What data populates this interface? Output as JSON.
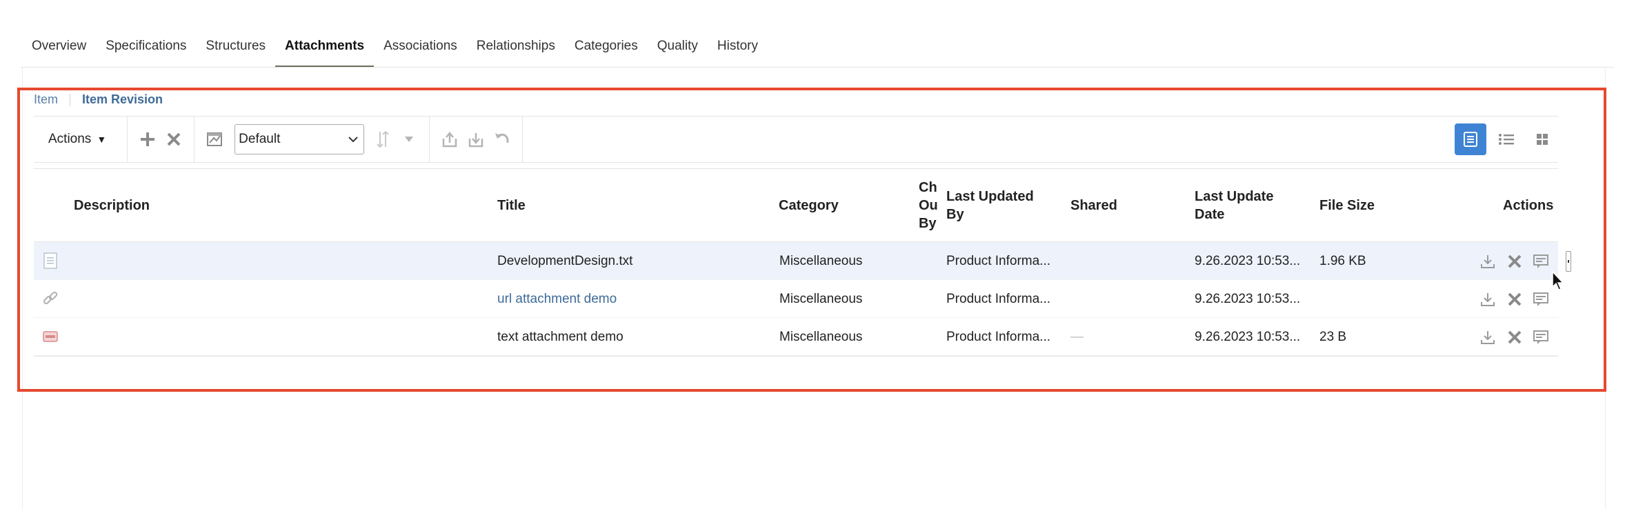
{
  "tabs": [
    {
      "label": "Overview",
      "active": false
    },
    {
      "label": "Specifications",
      "active": false
    },
    {
      "label": "Structures",
      "active": false
    },
    {
      "label": "Attachments",
      "active": true
    },
    {
      "label": "Associations",
      "active": false
    },
    {
      "label": "Relationships",
      "active": false
    },
    {
      "label": "Categories",
      "active": false
    },
    {
      "label": "Quality",
      "active": false
    },
    {
      "label": "History",
      "active": false
    }
  ],
  "breadcrumb": {
    "item": "Item",
    "current": "Item Revision"
  },
  "toolbar": {
    "actions_label": "Actions",
    "view_select_value": "Default",
    "icons": [
      "add-icon",
      "delete-icon",
      "export-icon",
      "chevron-down-icon",
      "sort-icon",
      "check-in-icon",
      "check-out-icon",
      "undo-icon"
    ],
    "view_modes": [
      "table-view-icon",
      "list-view-icon",
      "grid-view-icon"
    ],
    "accent_color": "#3f84d4"
  },
  "table": {
    "headers": {
      "description": "Description",
      "title": "Title",
      "category": "Category",
      "checked_out_by": "Ch Ou By",
      "last_updated_by": "Last Updated By",
      "shared": "Shared",
      "last_update_date": "Last Update Date",
      "file_size": "File Size",
      "actions": "Actions"
    },
    "rows": [
      {
        "type_icon": "text-file-icon",
        "title": "DevelopmentDesign.txt",
        "title_is_link": false,
        "category": "Miscellaneous",
        "last_updated_by": "Product Informa...",
        "shared": "",
        "last_update_date": "9.26.2023 10:53...",
        "file_size": "1.96 KB",
        "selected": true
      },
      {
        "type_icon": "link-icon",
        "title": "url attachment demo",
        "title_is_link": true,
        "category": "Miscellaneous",
        "last_updated_by": "Product Informa...",
        "shared": "",
        "last_update_date": "9.26.2023 10:53...",
        "file_size": "",
        "selected": false
      },
      {
        "type_icon": "text-attachment-icon",
        "title": "text attachment demo",
        "title_is_link": false,
        "category": "Miscellaneous",
        "last_updated_by": "Product Informa...",
        "shared": "—",
        "last_update_date": "9.26.2023 10:53...",
        "file_size": "23 B",
        "selected": false
      }
    ],
    "row_actions": [
      "download-icon",
      "delete-icon",
      "edit-comment-icon"
    ]
  },
  "highlight_color": "#e4492f"
}
